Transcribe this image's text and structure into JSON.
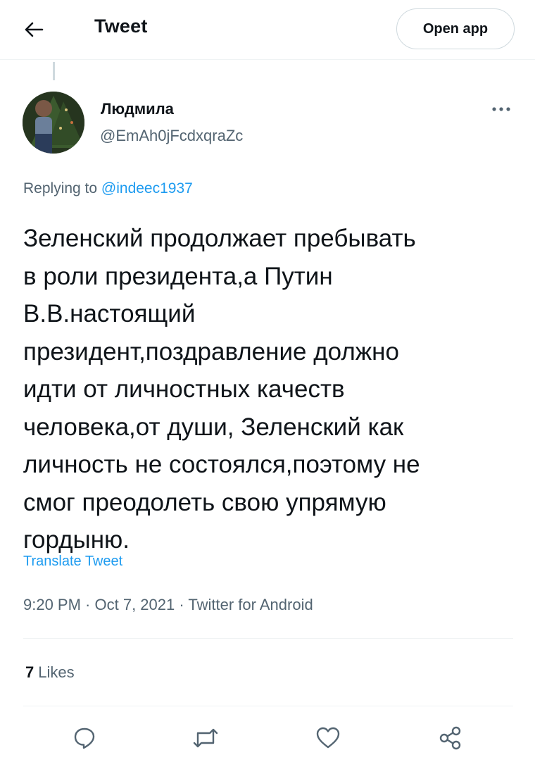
{
  "header": {
    "back_icon": "arrow-left-icon",
    "title": "Tweet",
    "open_app_label": "Open app"
  },
  "tweet": {
    "author": {
      "name": "Людмила",
      "handle": "@EmAh0jFcdxqraZc",
      "avatar": "profile photo"
    },
    "more_icon": "more-horizontal-icon",
    "replying_prefix": "Replying to ",
    "replying_to": "@indeec1937",
    "text": "Зеленский продолжает пребывать\nв роли президента,а Путин\nВ.В.настоящий\nпрезидент,поздравление должно\nидти от личностных качеств\nчеловека,от души, Зеленский как\nличность не состоялся,поэтому не\nсмог  преодолеть свою упрямую\nгордыню.",
    "translate_label": "Translate Tweet",
    "time": "9:20 PM",
    "separator": " · ",
    "date": "Oct 7, 2021",
    "source": "Twitter for Android",
    "likes_count": "7",
    "likes_label": "Likes"
  },
  "actions": [
    {
      "name": "reply",
      "icon": "reply-icon"
    },
    {
      "name": "retweet",
      "icon": "retweet-icon"
    },
    {
      "name": "like",
      "icon": "heart-icon"
    },
    {
      "name": "share",
      "icon": "share-icon"
    }
  ],
  "colors": {
    "accent": "#1d9bf0",
    "secondary_text": "#536471",
    "primary_text": "#0f1419",
    "border": "#eff3f4"
  }
}
